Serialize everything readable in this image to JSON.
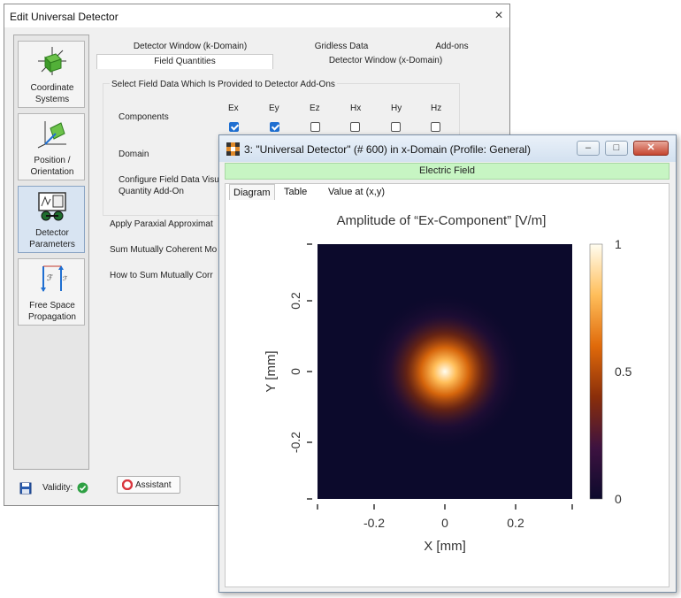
{
  "dialog": {
    "title": "Edit Universal Detector",
    "close": "×",
    "sidebar": [
      {
        "label": "Coordinate Systems",
        "icon": "coordinate-systems-icon"
      },
      {
        "label": "Position / Orientation",
        "icon": "position-orientation-icon"
      },
      {
        "label": "Detector Parameters",
        "icon": "detector-parameters-icon"
      },
      {
        "label": "Free Space Propagation",
        "icon": "free-space-propagation-icon"
      }
    ],
    "tabs_row1": [
      "Detector Window (k-Domain)",
      "Gridless Data",
      "Add-ons"
    ],
    "tabs_row2": [
      "Field Quantities",
      "Detector Window (x-Domain)"
    ],
    "group_title": "Select Field Data Which Is Provided to Detector Add-Ons",
    "components_label": "Components",
    "component_headers": [
      "Ex",
      "Ey",
      "Ez",
      "Hx",
      "Hy",
      "Hz"
    ],
    "component_checked": [
      true,
      true,
      false,
      false,
      false,
      false
    ],
    "domain_label": "Domain",
    "configure_label": [
      "Configure Field Data Visu",
      "Quantity Add-On"
    ],
    "options": [
      "Apply Paraxial Approximat",
      "Sum Mutually Coherent Mo",
      "How to Sum Mutually Corr"
    ],
    "validity_label": "Validity:",
    "assistant_label": "Assistant"
  },
  "window": {
    "title": "3: \"Universal Detector\" (# 600) in x-Domain (Profile: General)",
    "buttons": [
      "–",
      "□",
      "✕"
    ],
    "banner": "Electric Field",
    "tabs": [
      "Diagram",
      "Table",
      "Value at (x,y)"
    ]
  },
  "chart_data": {
    "type": "heatmap",
    "title": "Amplitude of “Ex-Component”  [V/m]",
    "xlabel": "X [mm]",
    "ylabel": "Y [mm]",
    "xlim": [
      -0.36,
      0.36
    ],
    "ylim": [
      -0.36,
      0.36
    ],
    "xticks": [
      -0.2,
      0,
      0.2
    ],
    "yticks": [
      -0.2,
      0,
      0.2
    ],
    "field": {
      "kind": "gaussian",
      "center_x": 0.0,
      "center_y": 0.0,
      "waist_mm": 0.075,
      "peak": 1
    },
    "colorbar": {
      "min": 0,
      "max": 1,
      "ticks": [
        0,
        0.5,
        1
      ]
    },
    "colormap": [
      "#0c0a2c",
      "#3d1240",
      "#8a2e0a",
      "#e06a0a",
      "#ffbe5a",
      "#fffdf0"
    ]
  }
}
